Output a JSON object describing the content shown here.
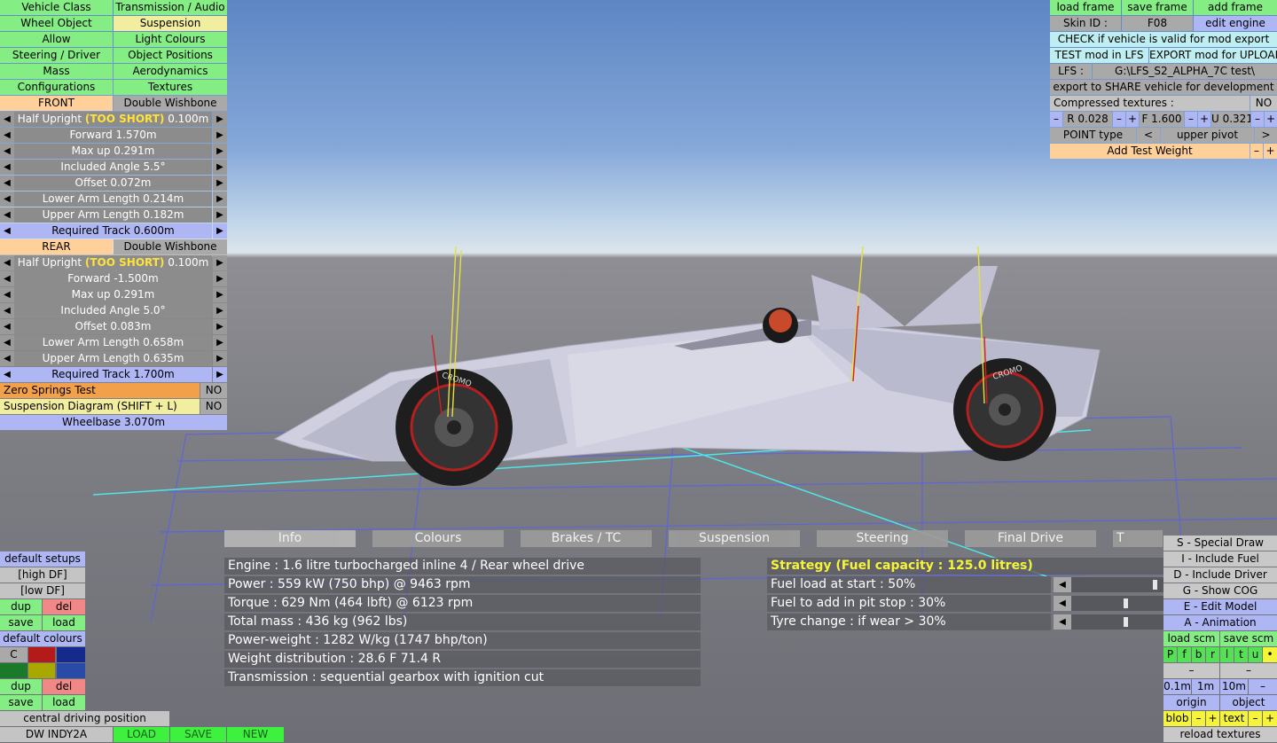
{
  "colors": {
    "sky": "#6f93cc",
    "ground": "#7d7d84",
    "green_button": "#84ee84",
    "yellow_button": "#f2eea0",
    "orange_button": "#ffd09a",
    "blue_button": "#aeb6f4",
    "cyan_button": "#bfeef2",
    "car_body": "#c8c8d8"
  },
  "left_nav": [
    [
      "Vehicle Class",
      "Transmission / Audio"
    ],
    [
      "Wheel Object",
      "Suspension"
    ],
    [
      "Allow",
      "Light Colours"
    ],
    [
      "Steering / Driver",
      "Object Positions"
    ],
    [
      "Mass",
      "Aerodynamics"
    ],
    [
      "Configurations",
      "Textures"
    ]
  ],
  "front": {
    "label": "FRONT",
    "type": "Double Wishbone",
    "half_upright_label": "Half Upright",
    "half_upright_warn": "(TOO SHORT)",
    "half_upright_value": "0.100m",
    "params": [
      "Forward 1.570m",
      "Max up 0.291m",
      "Included Angle 5.5°",
      "Offset 0.072m",
      "Lower Arm Length 0.214m",
      "Upper Arm Length 0.182m"
    ],
    "track": "Required Track 0.600m"
  },
  "rear": {
    "label": "REAR",
    "type": "Double Wishbone",
    "half_upright_label": "Half Upright",
    "half_upright_warn": "(TOO SHORT)",
    "half_upright_value": "0.100m",
    "params": [
      "Forward -1.500m",
      "Max up 0.291m",
      "Included Angle 5.0°",
      "Offset 0.083m",
      "Lower Arm Length 0.658m",
      "Upper Arm Length 0.635m"
    ],
    "track": "Required Track 1.700m"
  },
  "zero_springs": {
    "label": "Zero Springs Test",
    "value": "NO"
  },
  "susp_diagram": {
    "label": "Suspension Diagram (SHIFT + L)",
    "value": "NO"
  },
  "wheelbase": "Wheelbase 3.070m",
  "top_right": {
    "load_frame": "load frame",
    "save_frame": "save frame",
    "add_frame": "add frame",
    "skin_id_label": "Skin ID :",
    "skin_id_value": "F08",
    "edit_engine": "edit engine",
    "check_valid": "CHECK if vehicle is valid for mod export",
    "test_mod": "TEST mod in LFS",
    "export_mod": "EXPORT mod for UPLOAD",
    "lfs_label": "LFS :",
    "lfs_path": "G:\\LFS_S2_ALPHA_7C test\\",
    "export_share": "export to SHARE vehicle for development",
    "compressed_label": "Compressed textures :",
    "compressed_value": "NO",
    "r_value": "R 0.028",
    "f_value": "F 1.600",
    "u_value": "U 0.321",
    "minus": "–",
    "plus": "+",
    "point_type": "POINT type",
    "point_value": "upper pivot",
    "prev": "<",
    "next": ">",
    "add_weight": "Add Test Weight"
  },
  "tabs": [
    "Info",
    "Colours",
    "Brakes / TC",
    "Suspension",
    "Steering",
    "Final Drive",
    "T"
  ],
  "active_tab": "Info",
  "info_lines": [
    "Engine : 1.6 litre turbocharged inline 4 / Rear wheel drive",
    "Power : 559 kW (750 bhp) @ 9463 rpm",
    "Torque : 629 Nm (464 lbft) @ 6123 rpm",
    "Total mass : 436 kg (962 lbs)",
    "Power-weight : 1282 W/kg (1747 bhp/ton)",
    "Weight distribution : 28.6 F  71.4 R",
    "Transmission : sequential gearbox with ignition cut"
  ],
  "strategy": {
    "title": "Strategy (Fuel capacity : 125.0 litres)",
    "rows": [
      {
        "label": "Fuel load at start : 50%",
        "fraction": 0.95
      },
      {
        "label": "Fuel to add in pit stop : 30%",
        "fraction": 0.6
      },
      {
        "label": "Tyre change : if wear > 30%",
        "fraction": 0.6
      }
    ]
  },
  "bottom_left": {
    "default_setups": "default setups",
    "high_df": "[high DF]",
    "low_df": "[low DF]",
    "dup": "dup",
    "del": "del",
    "save": "save",
    "load": "load",
    "default_colours": "default colours",
    "c_label": "C",
    "swatches": [
      "#b51a1a",
      "#142a8c",
      "#1a7a2a",
      "#a8a800",
      "#2a4aa8"
    ],
    "central": "central driving position",
    "car_name": "DW INDY2A",
    "load_btn": "LOAD",
    "save_btn": "SAVE",
    "new_btn": "NEW"
  },
  "bottom_right": {
    "special_draw": "S - Special Draw",
    "include_fuel": "I - Include Fuel",
    "include_driver": "D - Include Driver",
    "show_cog": "G - Show COG",
    "edit_model": "E - Edit Model",
    "animation": "A - Animation",
    "load_scm": "load scm",
    "save_scm": "save scm",
    "toggles": [
      "P",
      "f",
      "b",
      "r",
      "l",
      "t",
      "u"
    ],
    "dot": "•",
    "dash": "–",
    "scale": [
      "0.1m",
      "1m",
      "10m"
    ],
    "origin": "origin",
    "object": "object",
    "blob": "blob",
    "text": "text",
    "minus": "–",
    "plus": "+",
    "reload": "reload textures"
  },
  "car": {
    "tyre_text": "CROMO"
  }
}
